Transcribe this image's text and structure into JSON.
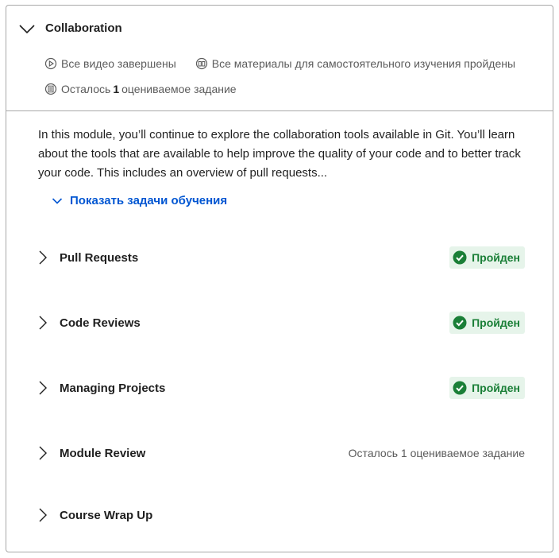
{
  "module": {
    "title": "Collaboration",
    "meta": {
      "videos": "Все видео завершены",
      "materials": "Все материалы для самостоятельного изучения пройдены",
      "remaining_prefix": "Осталось",
      "remaining_count": "1",
      "remaining_suffix": "оцениваемое задание"
    },
    "description": "In this module, you’ll continue to explore the collaboration tools available in Git. You’ll learn about the tools that are available to help improve the quality of your code and to better track your code. This includes an overview of pull requests...",
    "show_goals_label": "Показать задачи обучения"
  },
  "lessons": [
    {
      "name": "Pull Requests",
      "status": "Пройден"
    },
    {
      "name": "Code Reviews",
      "status": "Пройден"
    },
    {
      "name": "Managing Projects",
      "status": "Пройден"
    },
    {
      "name": "Module Review",
      "status": "Осталось 1 оцениваемое задание"
    },
    {
      "name": "Course Wrap Up",
      "status": ""
    }
  ],
  "colors": {
    "accent": "#0056d2",
    "success": "#1a7f37",
    "success_bg": "#e6f4ea",
    "border": "#a8a8a8"
  },
  "icons": {
    "collapse": "chevron-down-icon",
    "videos": "play-circle-icon",
    "materials": "reading-icon",
    "assignment": "quiz-icon",
    "lesson": "chevron-right-icon",
    "completed": "check-circle-icon"
  }
}
